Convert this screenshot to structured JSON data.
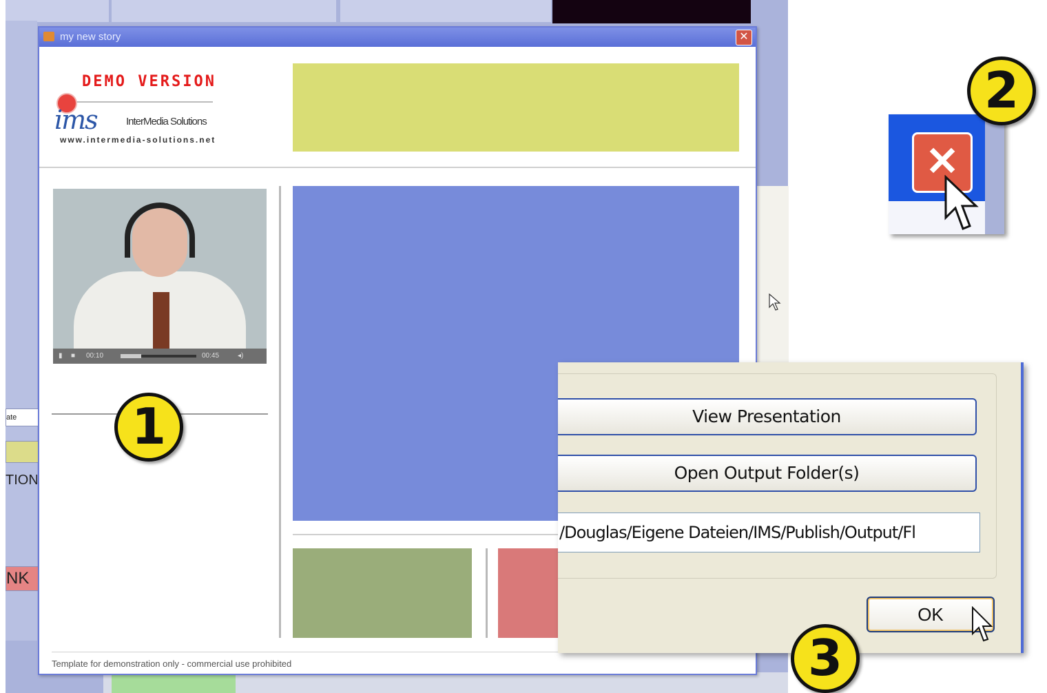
{
  "window": {
    "title": "my new story",
    "close_glyph": "✕"
  },
  "header": {
    "demo_label": "DEMO VERSION",
    "logo_mark": "ims",
    "logo_company": "InterMedia Solutions",
    "logo_url": "www.intermedia-solutions.net"
  },
  "video": {
    "time_current": "00:10",
    "time_total": "00:45",
    "icons": [
      "play-icon",
      "stop-icon",
      "volume-icon"
    ]
  },
  "footer": {
    "text": "Template for demonstration only - commercial use prohibited"
  },
  "dialog": {
    "view_button": "View Presentation",
    "open_button": "Open Output Folder(s)",
    "output_path": "/Douglas/Eigene Dateien/IMS/Publish/Output/Fl",
    "ok_button": "OK"
  },
  "background": {
    "left_labels": [
      "ate",
      "TION",
      "NK"
    ]
  },
  "zoom": {
    "close_glyph": "✕"
  },
  "badges": [
    "1",
    "2",
    "3"
  ],
  "colors": {
    "banner": "#d9dd75",
    "main_block": "#778bda",
    "green_block": "#9aad7a",
    "red_block": "#d97979",
    "demo_red": "#e41a1a",
    "badge_yellow": "#f6e21b"
  }
}
